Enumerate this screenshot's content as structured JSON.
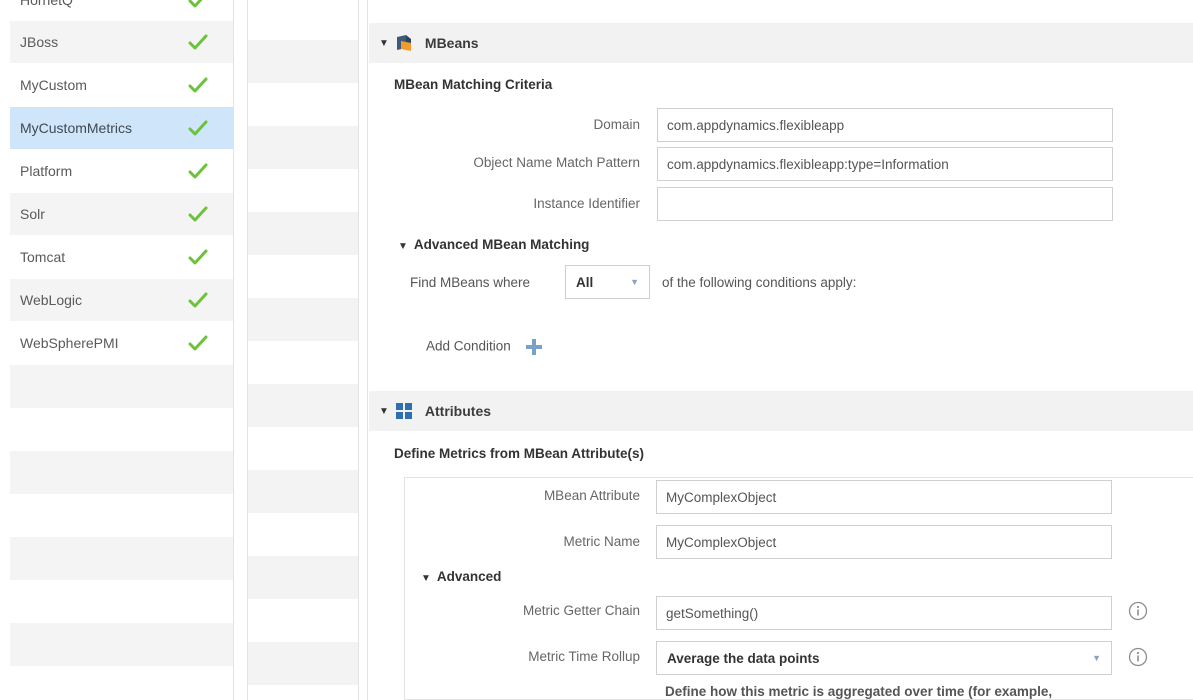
{
  "rules": [
    {
      "label": "HornetQ",
      "checked": true
    },
    {
      "label": "JBoss",
      "checked": true
    },
    {
      "label": "MyCustom",
      "checked": true
    },
    {
      "label": "MyCustomMetrics",
      "checked": true,
      "selected": true
    },
    {
      "label": "Platform",
      "checked": true
    },
    {
      "label": "Solr",
      "checked": true
    },
    {
      "label": "Tomcat",
      "checked": true
    },
    {
      "label": "WebLogic",
      "checked": true
    },
    {
      "label": "WebSpherePMI",
      "checked": true
    }
  ],
  "colors": {
    "check": "#6cc33b",
    "selected_row": "#cfe5f9",
    "mbean_icon": "#f39c2b",
    "mbean_icon_dark": "#3d5a78",
    "attributes_icon": "#2f6fb0",
    "plus": "#7aa1c7"
  },
  "mbeans": {
    "header": "MBeans",
    "icon": "mbean-cube-icon",
    "criteria_heading": "MBean Matching Criteria",
    "domain_label": "Domain",
    "domain_value": "com.appdynamics.flexibleapp",
    "object_name_label": "Object Name Match Pattern",
    "object_name_value": "com.appdynamics.flexibleapp:type=Information",
    "instance_label": "Instance Identifier",
    "instance_value": "",
    "advanced_heading": "Advanced MBean Matching",
    "find_prefix": "Find MBeans where",
    "find_select": "All",
    "find_suffix": "of the following conditions apply:",
    "add_condition": "Add Condition"
  },
  "attributes": {
    "header": "Attributes",
    "icon": "grid-icon",
    "define_heading": "Define Metrics from MBean Attribute(s)",
    "mbean_attr_label": "MBean Attribute",
    "mbean_attr_value": "MyComplexObject",
    "metric_name_label": "Metric Name",
    "metric_name_value": "MyComplexObject",
    "advanced_heading": "Advanced",
    "getter_label": "Metric Getter Chain",
    "getter_value": "getSomething()",
    "rollup_label": "Metric Time Rollup",
    "rollup_value": "Average the data points",
    "rollup_help": "Define how this metric is aggregated over time (for example,"
  }
}
